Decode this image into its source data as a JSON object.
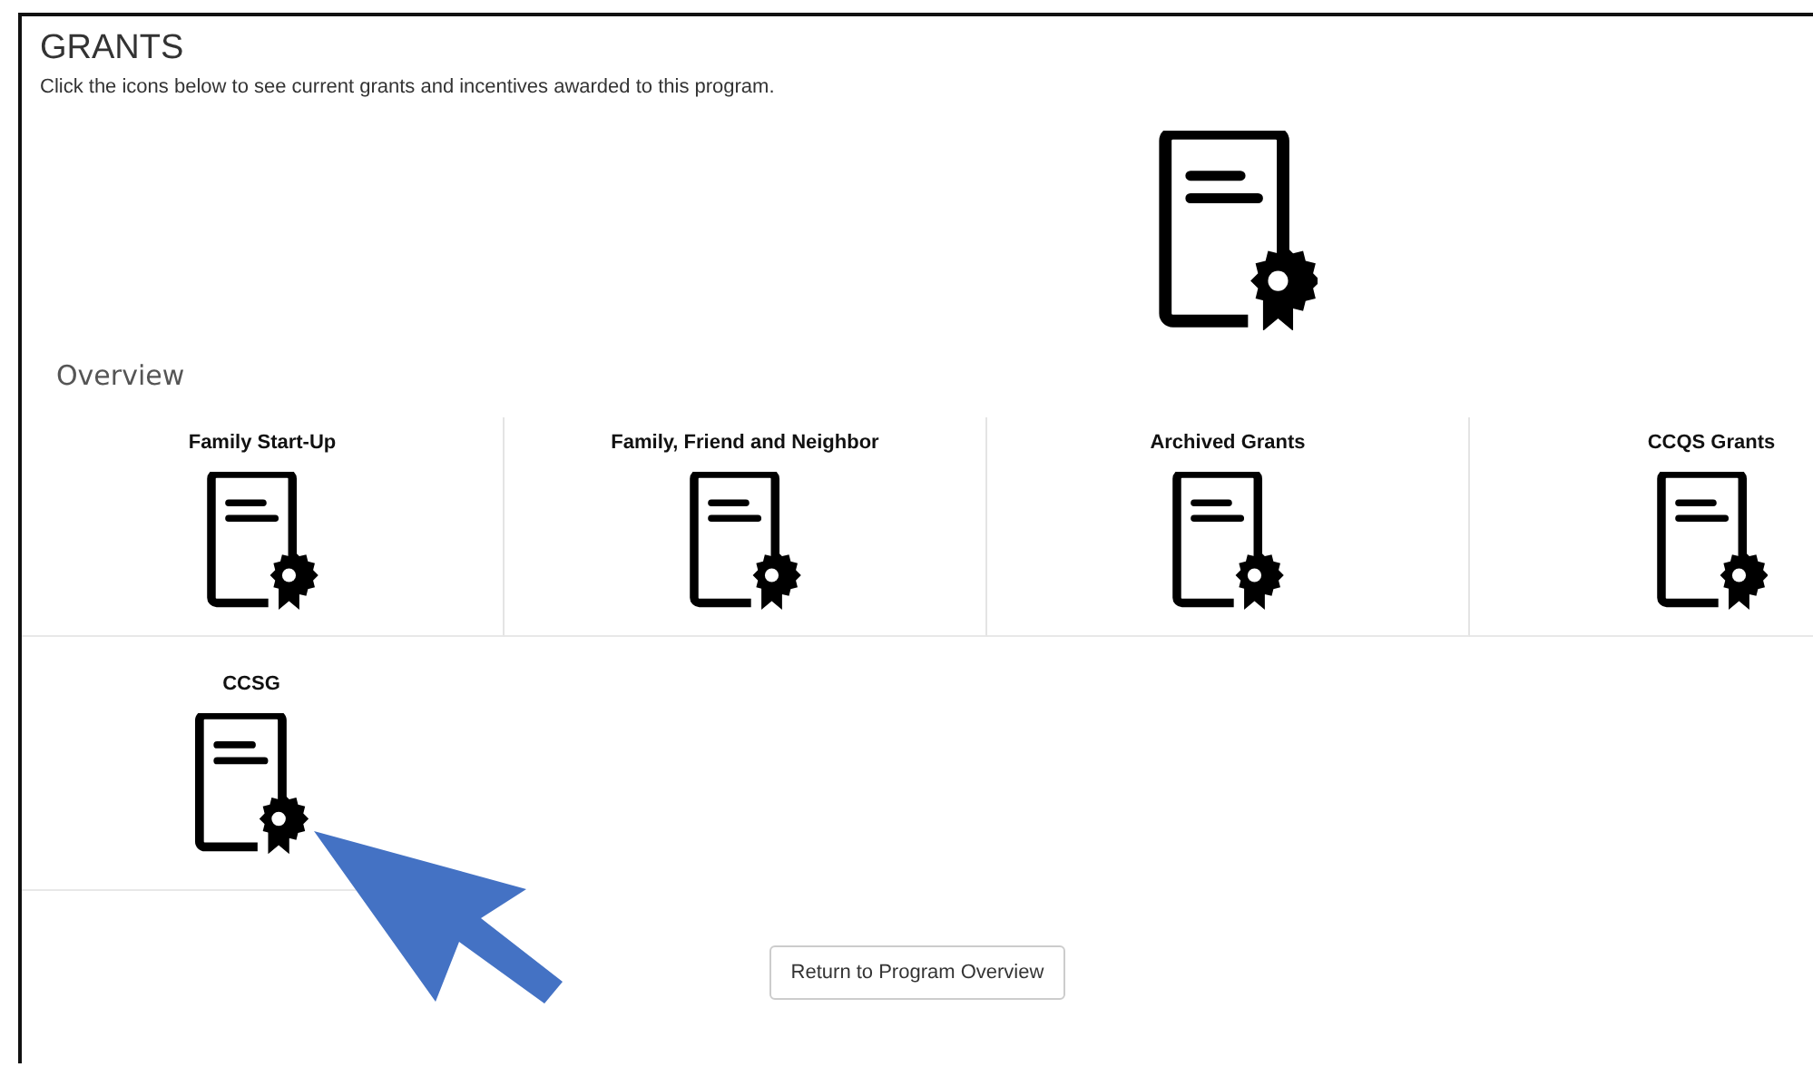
{
  "header": {
    "title": "GRANTS",
    "description": "Click the icons below to see current grants and incentives awarded to this program."
  },
  "section": {
    "title": "Overview"
  },
  "grants": [
    {
      "label": "Family Start-Up"
    },
    {
      "label": "Family, Friend and Neighbor"
    },
    {
      "label": "Archived Grants"
    },
    {
      "label": "CCQS Grants"
    },
    {
      "label": "CCSG"
    }
  ],
  "button": {
    "label": "Return to Program Overview"
  }
}
